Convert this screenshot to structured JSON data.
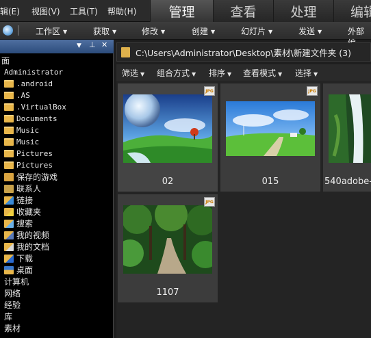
{
  "menu": {
    "items": [
      "辑(E)",
      "视图(V)",
      "工具(T)",
      "帮助(H)"
    ]
  },
  "tabs": [
    {
      "label": "管理",
      "active": true
    },
    {
      "label": "查看",
      "active": false
    },
    {
      "label": "处理",
      "active": false
    },
    {
      "label": "编辑",
      "active": false
    }
  ],
  "toolbar": {
    "items": [
      "工作区",
      "获取",
      "修改",
      "创建",
      "幻灯片",
      "发送",
      "外部编"
    ]
  },
  "left_panel": {
    "controls": [
      "▼",
      "⊥",
      "✕"
    ],
    "tree": [
      {
        "label": "面",
        "icon": "none",
        "mono": false
      },
      {
        "label": "Administrator",
        "icon": "none",
        "mono": true
      },
      {
        "label": ".android",
        "icon": "folder",
        "mono": true
      },
      {
        "label": ".AS",
        "icon": "folder",
        "mono": true
      },
      {
        "label": ".VirtualBox",
        "icon": "folder",
        "mono": true
      },
      {
        "label": "Documents",
        "icon": "folder",
        "mono": true
      },
      {
        "label": "Music",
        "icon": "folder",
        "mono": true
      },
      {
        "label": "Music",
        "icon": "folder",
        "mono": true
      },
      {
        "label": "Pictures",
        "icon": "folder",
        "mono": true
      },
      {
        "label": "Pictures",
        "icon": "folder",
        "mono": true
      },
      {
        "label": "保存的游戏",
        "icon": "games",
        "mono": false
      },
      {
        "label": "联系人",
        "icon": "contacts",
        "mono": false
      },
      {
        "label": "链接",
        "icon": "links",
        "mono": false
      },
      {
        "label": "收藏夹",
        "icon": "favorites",
        "mono": false
      },
      {
        "label": "搜索",
        "icon": "search",
        "mono": false
      },
      {
        "label": "我的视频",
        "icon": "videos",
        "mono": false
      },
      {
        "label": "我的文档",
        "icon": "documents",
        "mono": false
      },
      {
        "label": "下载",
        "icon": "downloads",
        "mono": false
      },
      {
        "label": "桌面",
        "icon": "desktop",
        "mono": false
      },
      {
        "label": "计算机",
        "icon": "none",
        "mono": false
      },
      {
        "label": "网络",
        "icon": "none",
        "mono": false
      },
      {
        "label": "经验",
        "icon": "none",
        "mono": false
      },
      {
        "label": "库",
        "icon": "none",
        "mono": false
      },
      {
        "label": "素材",
        "icon": "none",
        "mono": false
      }
    ]
  },
  "path": {
    "text": "C:\\Users\\Administrator\\Desktop\\素材\\新建文件夹 (3)"
  },
  "filterbar": {
    "items": [
      "筛选",
      "组合方式",
      "排序",
      "查看模式",
      "选择"
    ]
  },
  "thumbnails": [
    {
      "caption": "02",
      "badge": "JPG"
    },
    {
      "caption": "015",
      "badge": "JPG"
    },
    {
      "caption": "540adobe-",
      "badge": ""
    },
    {
      "caption": "1107",
      "badge": "JPG"
    }
  ],
  "colors": {
    "panel_header": "#3b5d92",
    "folder": "#e8b64a",
    "background": "#1e1e1e"
  }
}
